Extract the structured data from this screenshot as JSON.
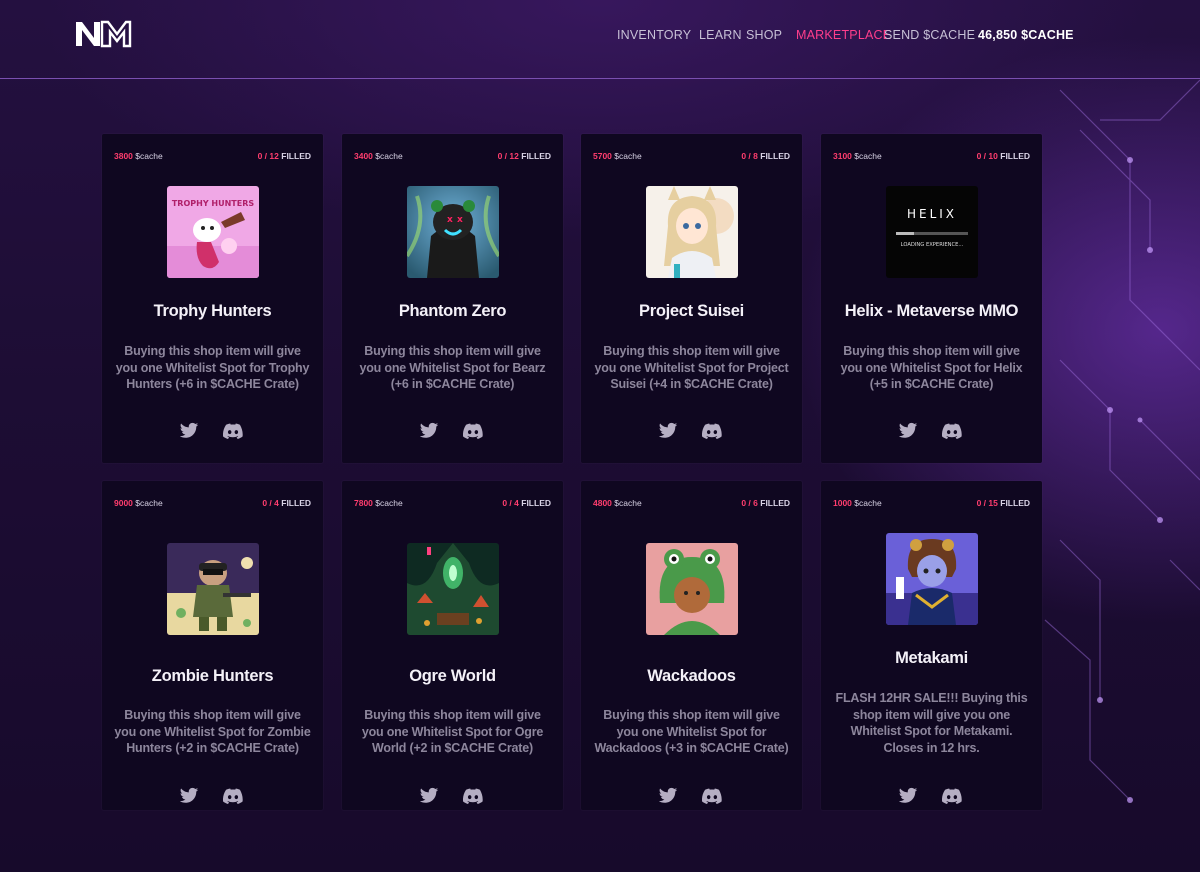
{
  "header": {
    "logo_text": "NM",
    "nav": [
      {
        "label": "INVENTORY",
        "active": false
      },
      {
        "label": "LEARN",
        "active": false
      },
      {
        "label": "SHOP",
        "active": false
      },
      {
        "label": "MARKETPLACE",
        "active": true
      },
      {
        "label": "SEND $CACHE",
        "active": false
      }
    ],
    "balance": "46,850 $CACHE"
  },
  "colors": {
    "accent": "#ff3d8b",
    "price": "#ff3d6e",
    "card_bg": "#0f0720",
    "page_bg": "#1c0d33"
  },
  "price_unit": "$cache",
  "filled_label": "FILLED",
  "cards": [
    {
      "price": "3800",
      "filled": "0",
      "total": "12",
      "title": "Trophy Hunters",
      "description": "Buying this shop item will give you one Whitelist Spot for Trophy Hunters (+6 in $CACHE Crate)",
      "image": "trophy-hunters-art",
      "image_text": "TROPHY HUNTERS"
    },
    {
      "price": "3400",
      "filled": "0",
      "total": "12",
      "title": "Phantom Zero",
      "description": "Buying this shop item will give you one Whitelist Spot for Bearz (+6 in $CACHE Crate)",
      "image": "phantom-zero-art"
    },
    {
      "price": "5700",
      "filled": "0",
      "total": "8",
      "title": "Project Suisei",
      "description": "Buying this shop item will give you one Whitelist Spot for Project Suisei (+4 in $CACHE Crate)",
      "image": "project-suisei-art"
    },
    {
      "price": "3100",
      "filled": "0",
      "total": "10",
      "title": "Helix - Metaverse MMO",
      "description": "Buying this shop item will give you one Whitelist Spot for Helix (+5 in $CACHE Crate)",
      "image": "helix-art",
      "image_text": "HELIX",
      "image_subtext": "LOADING EXPERIENCE..."
    },
    {
      "price": "9000",
      "filled": "0",
      "total": "4",
      "title": "Zombie Hunters",
      "description": "Buying this shop item will give you one Whitelist Spot for Zombie Hunters (+2 in $CACHE Crate)",
      "image": "zombie-hunters-art"
    },
    {
      "price": "7800",
      "filled": "0",
      "total": "4",
      "title": "Ogre World",
      "description": "Buying this shop item will give you one Whitelist Spot for Ogre World (+2 in $CACHE Crate)",
      "image": "ogre-world-art"
    },
    {
      "price": "4800",
      "filled": "0",
      "total": "6",
      "title": "Wackadoos",
      "description": "Buying this shop item will give you one Whitelist Spot for Wackadoos (+3 in $CACHE Crate)",
      "image": "wackadoos-art"
    },
    {
      "price": "1000",
      "filled": "0",
      "total": "15",
      "title": "Metakami",
      "description": "FLASH 12HR SALE!!! Buying this shop item will give you one Whitelist Spot for Metakami. Closes in 12 hrs.",
      "image": "metakami-art"
    }
  ]
}
